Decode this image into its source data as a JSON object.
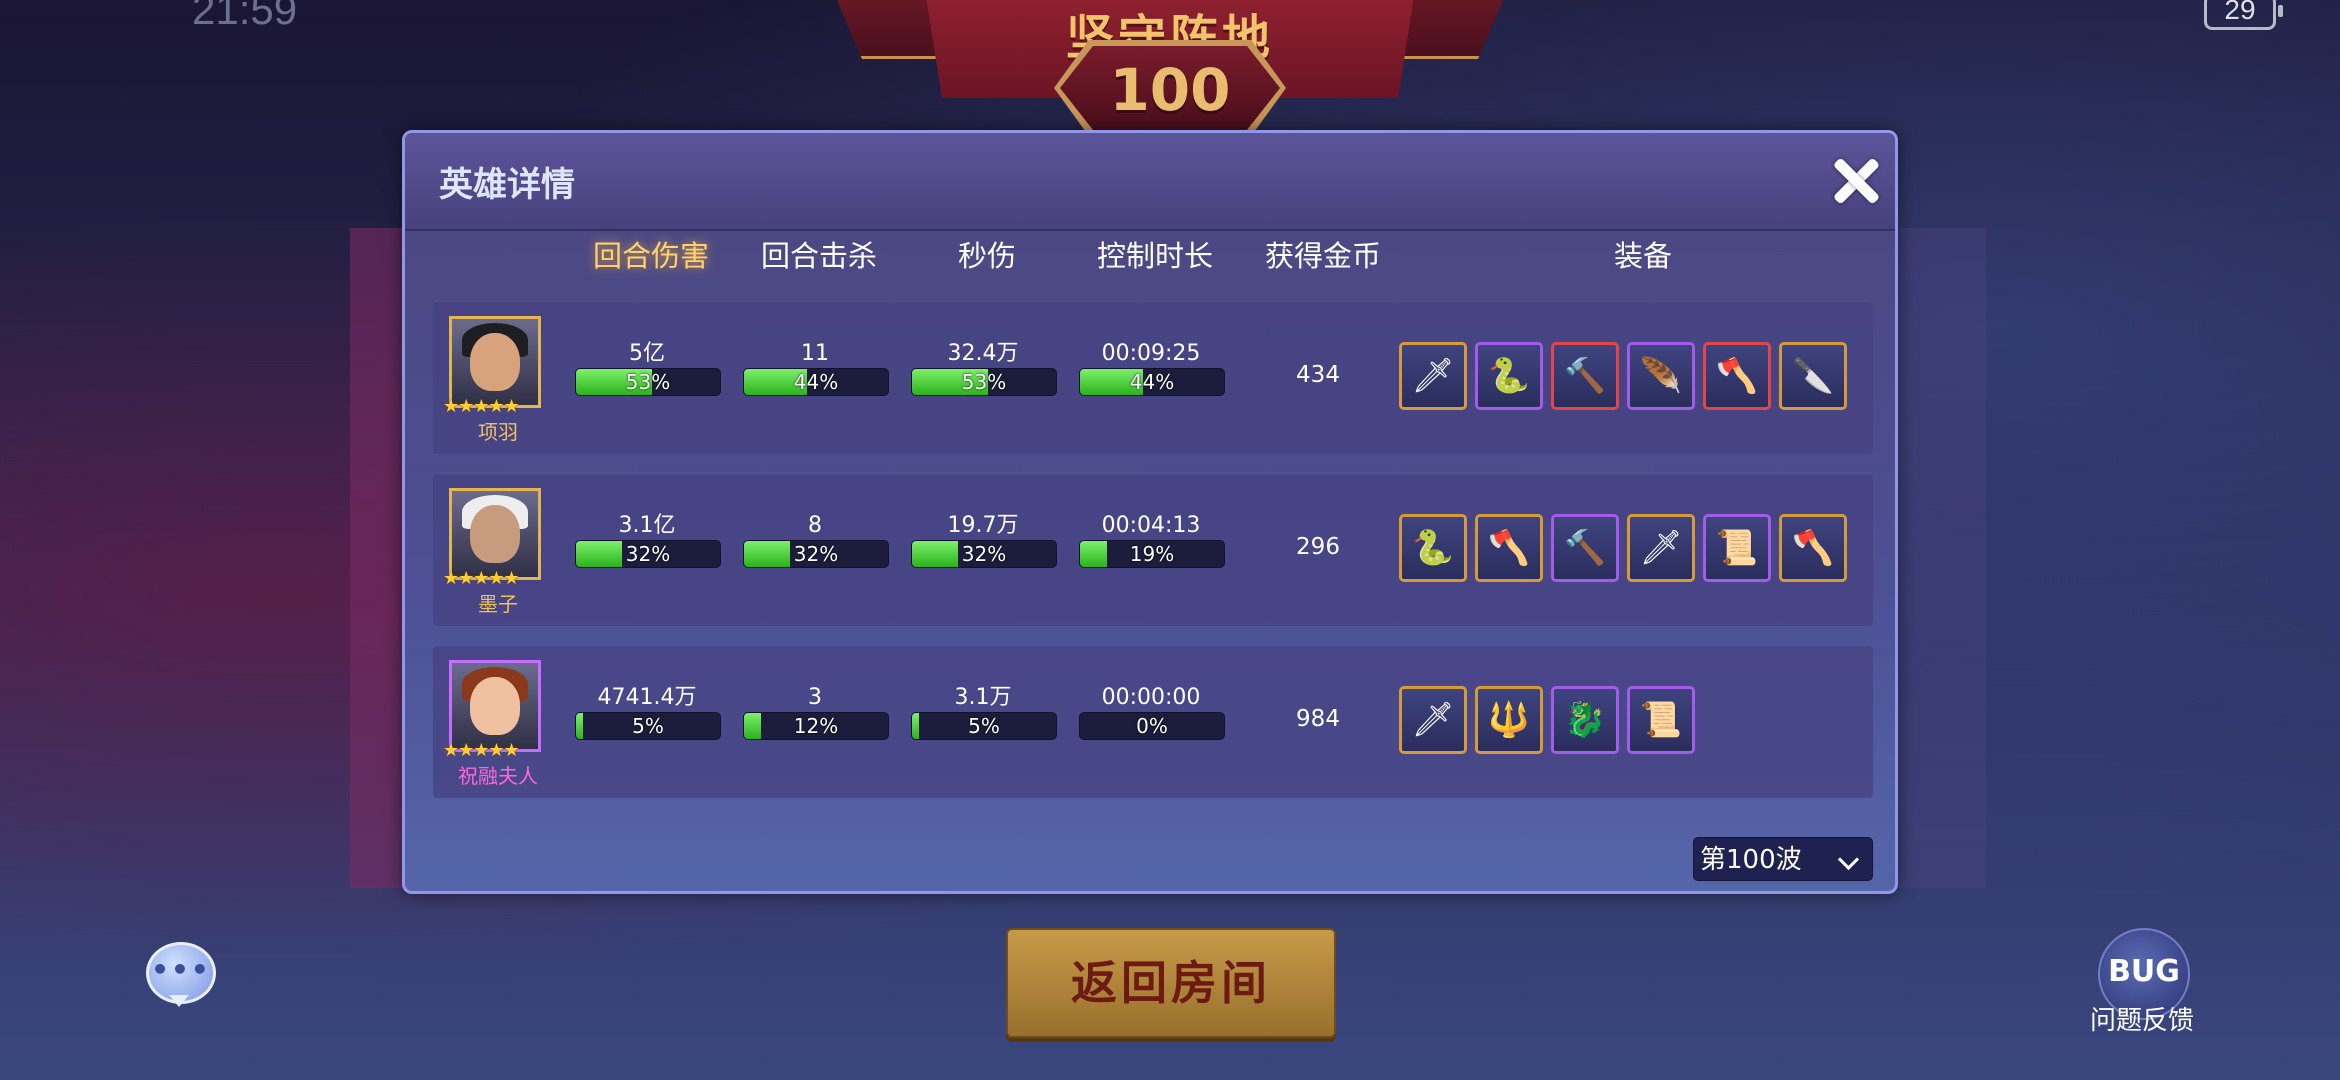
{
  "status_bar": {
    "time": "21:59",
    "battery": "29"
  },
  "banner": {
    "title": "坚守阵地",
    "wave_number": "100"
  },
  "dialog": {
    "title": "英雄详情",
    "columns": [
      "回合伤害",
      "回合击杀",
      "秒伤",
      "控制时长",
      "获得金币",
      "装备"
    ],
    "active_column": "回合伤害",
    "rows": [
      {
        "hero": "项羽",
        "stars": 5,
        "rarity_color": "#e4b450",
        "damage": {
          "value": "5亿",
          "pct": "53%",
          "fraction": 0.53
        },
        "kills": {
          "value": "11",
          "pct": "44%",
          "fraction": 0.44
        },
        "dps": {
          "value": "32.4万",
          "pct": "53%",
          "fraction": 0.53
        },
        "control": {
          "value": "00:09:25",
          "pct": "44%",
          "fraction": 0.44
        },
        "gold": "434",
        "equipment": [
          {
            "icon": "sword-icon",
            "rarity": "gold"
          },
          {
            "icon": "serpent-chain-icon",
            "rarity": "purple"
          },
          {
            "icon": "war-hammer-icon",
            "rarity": "red"
          },
          {
            "icon": "wing-cape-icon",
            "rarity": "purple"
          },
          {
            "icon": "battle-axe-icon",
            "rarity": "red"
          },
          {
            "icon": "red-blade-icon",
            "rarity": "gold"
          }
        ]
      },
      {
        "hero": "墨子",
        "stars": 5,
        "rarity_color": "#e4b450",
        "damage": {
          "value": "3.1亿",
          "pct": "32%",
          "fraction": 0.32
        },
        "kills": {
          "value": "8",
          "pct": "32%",
          "fraction": 0.32
        },
        "dps": {
          "value": "19.7万",
          "pct": "32%",
          "fraction": 0.32
        },
        "control": {
          "value": "00:04:13",
          "pct": "19%",
          "fraction": 0.19
        },
        "gold": "296",
        "equipment": [
          {
            "icon": "serpent-chain-icon",
            "rarity": "gold"
          },
          {
            "icon": "battle-axe-icon",
            "rarity": "gold"
          },
          {
            "icon": "frost-hammer-icon",
            "rarity": "purple"
          },
          {
            "icon": "sword-icon",
            "rarity": "gold"
          },
          {
            "icon": "scroll-icon",
            "rarity": "purple"
          },
          {
            "icon": "axe-icon",
            "rarity": "gold"
          }
        ]
      },
      {
        "hero": "祝融夫人",
        "stars": 5,
        "rarity_color": "#c66cff",
        "damage": {
          "value": "4741.4万",
          "pct": "5%",
          "fraction": 0.05
        },
        "kills": {
          "value": "3",
          "pct": "12%",
          "fraction": 0.12
        },
        "dps": {
          "value": "3.1万",
          "pct": "5%",
          "fraction": 0.05
        },
        "control": {
          "value": "00:00:00",
          "pct": "0%",
          "fraction": 0.0
        },
        "gold": "984",
        "equipment": [
          {
            "icon": "serpent-blade-icon",
            "rarity": "gold"
          },
          {
            "icon": "spear-icon",
            "rarity": "gold"
          },
          {
            "icon": "green-dragon-icon",
            "rarity": "purple"
          },
          {
            "icon": "scroll-icon",
            "rarity": "purple"
          }
        ]
      }
    ],
    "wave_select": "第100波"
  },
  "buttons": {
    "return": "返回房间",
    "bug": "BUG",
    "feedback": "问题反馈",
    "chat_dots": "•••"
  }
}
